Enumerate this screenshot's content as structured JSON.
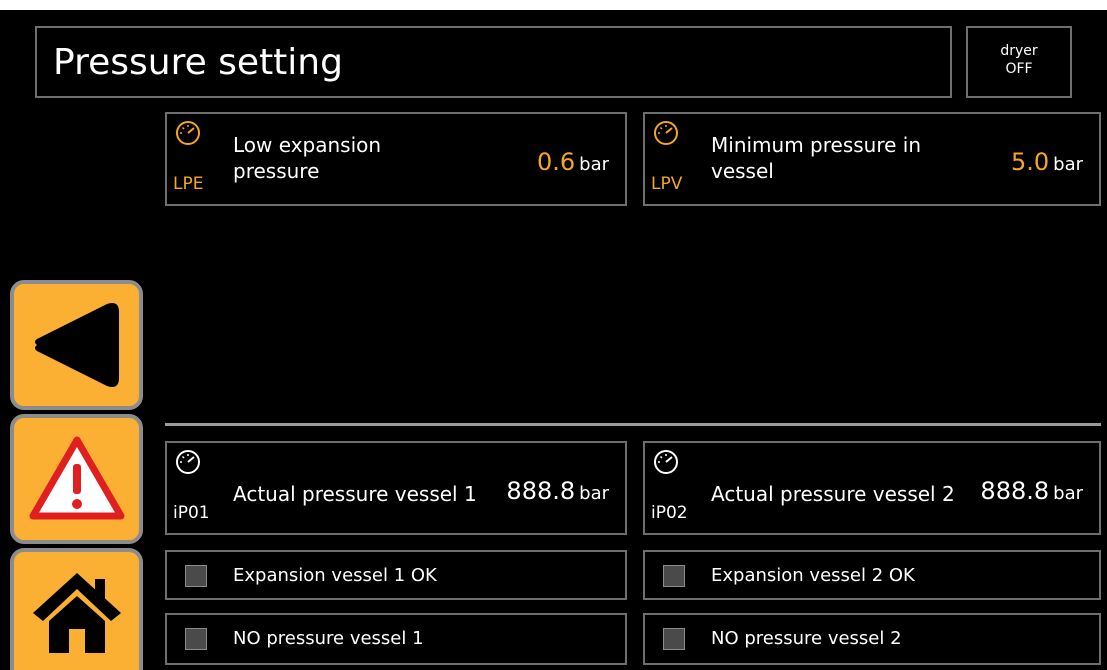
{
  "header": {
    "title": "Pressure setting"
  },
  "dryer": {
    "label": "dryer",
    "state": "OFF"
  },
  "colors": {
    "accent": "#f5a623",
    "button": "#fbb034",
    "border": "#6e6e6e",
    "alarm": "#e02020"
  },
  "settings": [
    {
      "code": "LPE",
      "label_line1": "Low expansion",
      "label_line2": "pressure",
      "value": "0.6",
      "unit": "bar",
      "icon": "gauge-icon"
    },
    {
      "code": "LPV",
      "label_line1": "Minimum pressure in",
      "label_line2": "vessel",
      "value": "5.0",
      "unit": "bar",
      "icon": "gauge-icon"
    }
  ],
  "readings": [
    {
      "code": "iP01",
      "label": "Actual pressure vessel 1",
      "value": "888.8",
      "unit": "bar",
      "icon": "gauge-icon"
    },
    {
      "code": "iP02",
      "label": "Actual pressure vessel 2",
      "value": "888.8",
      "unit": "bar",
      "icon": "gauge-icon"
    }
  ],
  "status": [
    {
      "label": "Expansion vessel 1 OK"
    },
    {
      "label": "Expansion vessel 2 OK"
    },
    {
      "label": "NO pressure vessel 1"
    },
    {
      "label": "NO pressure vessel 2"
    }
  ],
  "nav": [
    {
      "icon": "back-arrow-icon"
    },
    {
      "icon": "alarm-warning-icon"
    },
    {
      "icon": "home-icon"
    }
  ]
}
